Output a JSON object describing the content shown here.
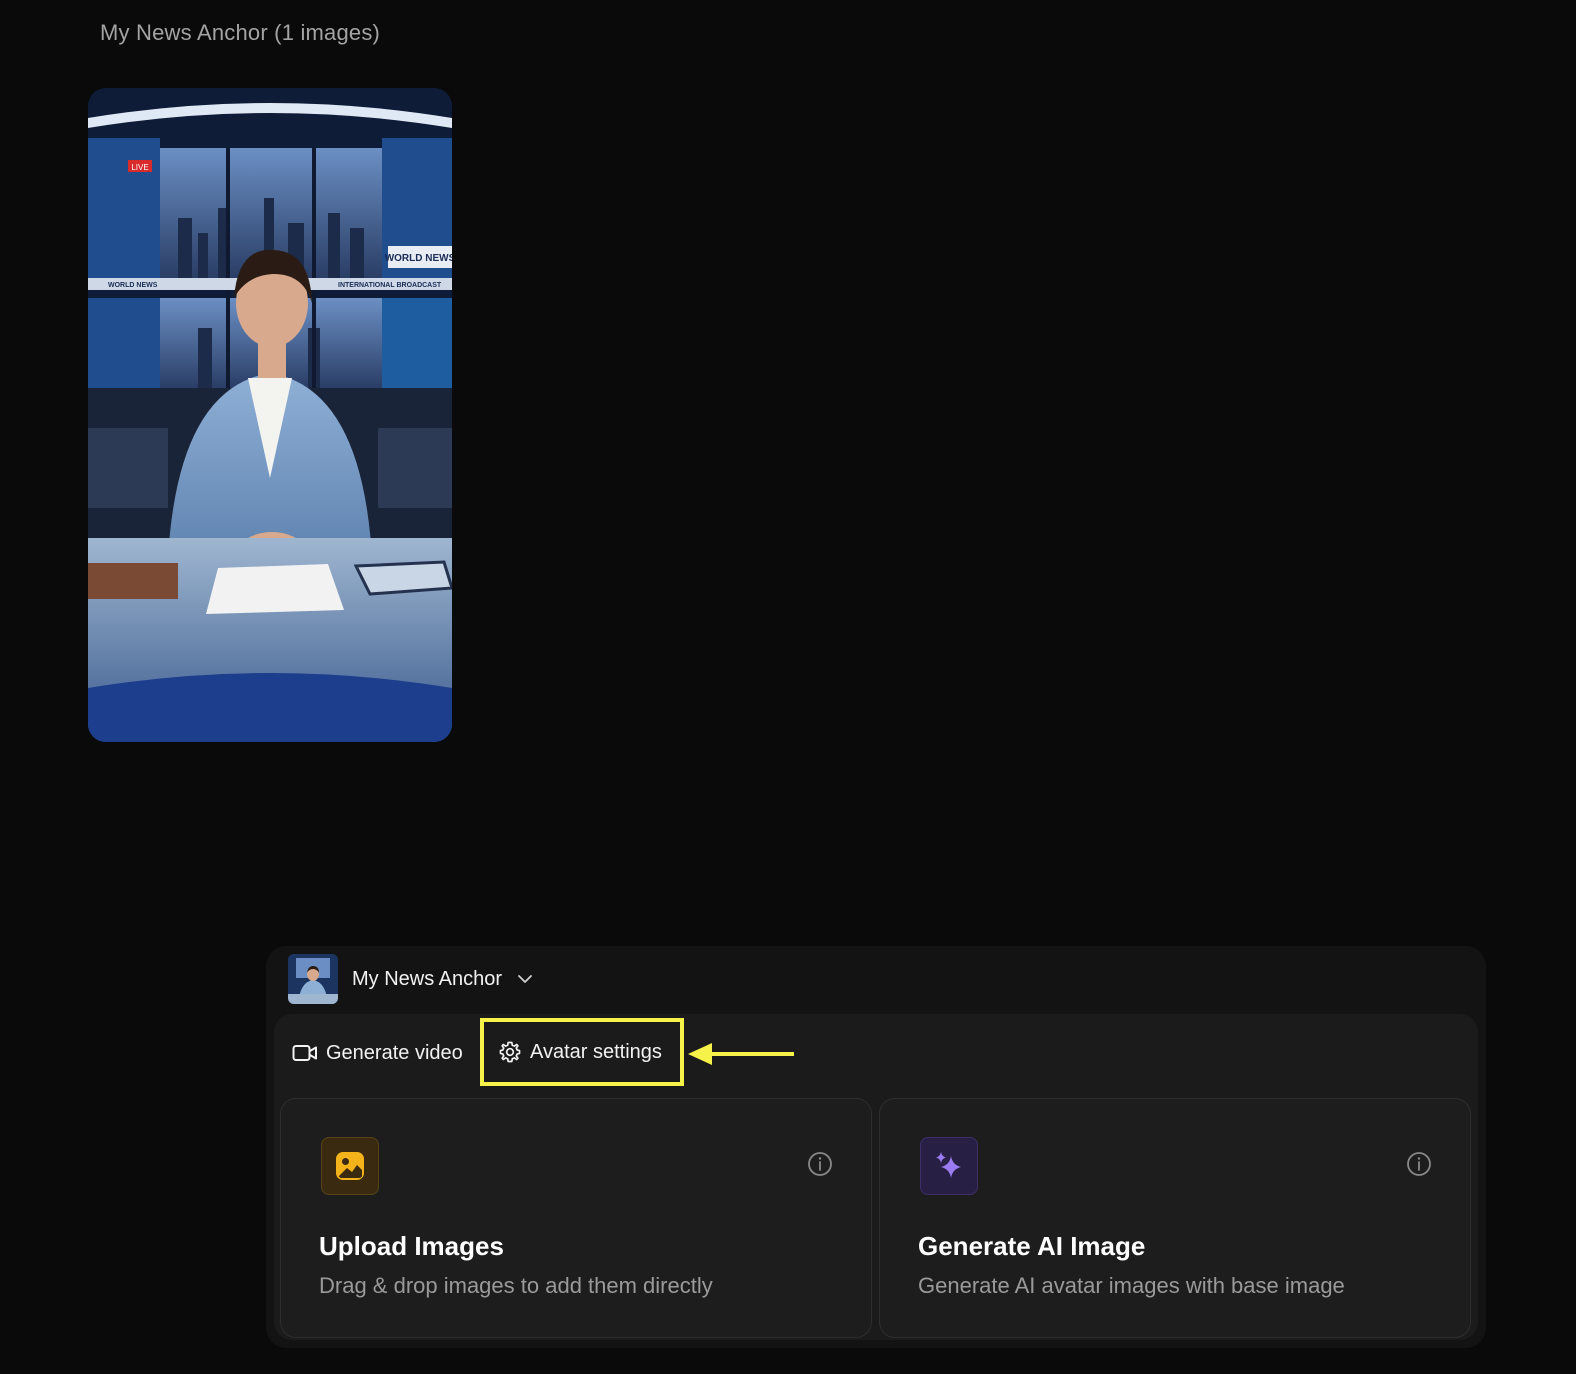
{
  "gallery": {
    "title": "My News Anchor (1 images)"
  },
  "selector": {
    "avatar_name": "My News Anchor"
  },
  "tabs": {
    "generate_video": "Generate video",
    "avatar_settings": "Avatar settings"
  },
  "cards": {
    "upload": {
      "title": "Upload Images",
      "description": "Drag & drop images to add them directly",
      "icon": "image-icon"
    },
    "generate": {
      "title": "Generate AI Image",
      "description": "Generate AI avatar images with base image",
      "icon": "sparkles-icon"
    }
  },
  "annotation": {
    "highlight_color": "#f7f24a",
    "target": "Avatar settings"
  },
  "image_overlay_text": {
    "live": "LIVE",
    "world_news": "WORLD NEWS",
    "ticker_1": "WORLD NEWS",
    "ticker_2": "INTERNATIONAL BROADCAST"
  }
}
